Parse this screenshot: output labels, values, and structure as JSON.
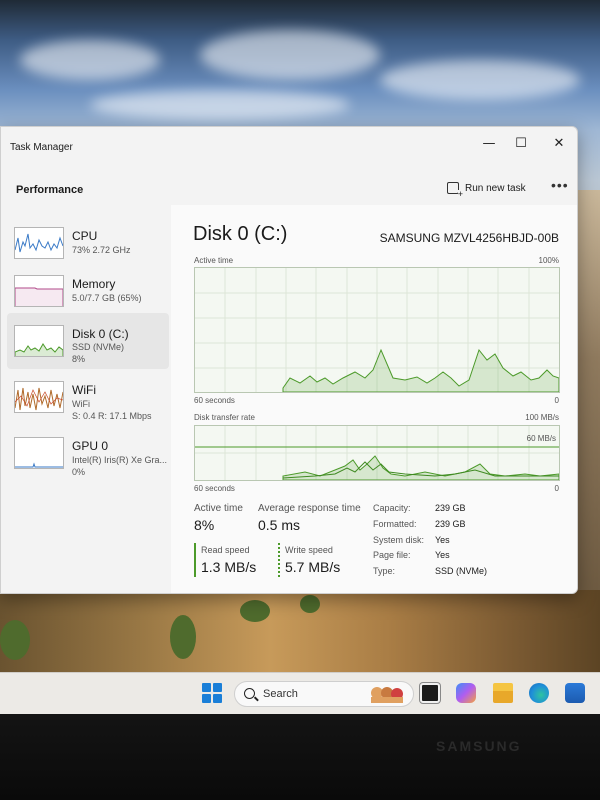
{
  "window": {
    "app_title": "Task Manager",
    "controls": {
      "minimize": "—",
      "maximize": "☐",
      "close": "✕"
    }
  },
  "header": {
    "section": "Performance",
    "run_new_task": "Run new task",
    "more": "•••"
  },
  "sidebar": {
    "items": [
      {
        "name": "CPU",
        "line1": "73% 2.72 GHz",
        "line2": "",
        "active": false,
        "color": "#3a7ac7"
      },
      {
        "name": "Memory",
        "line1": "5.0/7.7 GB (65%)",
        "line2": "",
        "active": false,
        "color": "#b14a8a"
      },
      {
        "name": "Disk 0 (C:)",
        "line1": "SSD (NVMe)",
        "line2": "8%",
        "active": true,
        "color": "#4c9a2a"
      },
      {
        "name": "WiFi",
        "line1": "WiFi",
        "line2": "S: 0.4  R: 17.1 Mbps",
        "active": false,
        "color": "#b06a2a"
      },
      {
        "name": "GPU 0",
        "line1": "Intel(R) Iris(R) Xe Gra...",
        "line2": "0%",
        "active": false,
        "color": "#3a7ac7"
      }
    ]
  },
  "main": {
    "title": "Disk 0 (C:)",
    "model": "SAMSUNG MZVL4256HBJD-00B",
    "active_time_chart": {
      "label": "Active time",
      "max_label": "100%",
      "x_left": "60 seconds",
      "x_right": "0"
    },
    "transfer_chart": {
      "label": "Disk transfer rate",
      "max_label": "100 MB/s",
      "ref_label": "60 MB/s",
      "x_left": "60 seconds",
      "x_right": "0"
    },
    "stats": {
      "active_time_label": "Active time",
      "active_time_value": "8%",
      "avg_response_label": "Average response time",
      "avg_response_value": "0.5 ms",
      "read_label": "Read speed",
      "read_value": "1.3 MB/s",
      "write_label": "Write speed",
      "write_value": "5.7 MB/s"
    },
    "properties": [
      {
        "label": "Capacity:",
        "value": "239 GB"
      },
      {
        "label": "Formatted:",
        "value": "239 GB"
      },
      {
        "label": "System disk:",
        "value": "Yes"
      },
      {
        "label": "Page file:",
        "value": "Yes"
      },
      {
        "label": "Type:",
        "value": "SSD (NVMe)"
      }
    ]
  },
  "taskbar": {
    "search_placeholder": "Search"
  },
  "device": {
    "brand": "SAMSUNG"
  },
  "colors": {
    "accent": "#4c9a2a",
    "window_bg": "#f3f3f3",
    "active_item": "#e6e6e6"
  }
}
